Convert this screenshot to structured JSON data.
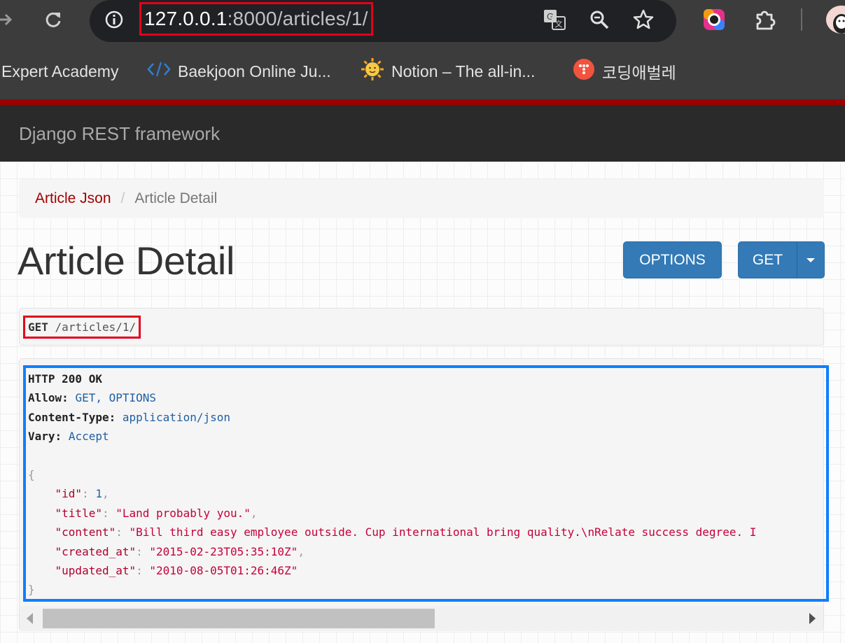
{
  "browser": {
    "url_host": "127.0.0.1",
    "url_path": ":8000/articles/1/",
    "icons": [
      "forward-icon",
      "reload-icon",
      "site-info-icon",
      "translate-icon",
      "zoom-icon",
      "star-icon",
      "extension-color-icon",
      "extensions-puzzle-icon",
      "profile-avatar"
    ],
    "bookmarks": [
      {
        "label": "Expert Academy",
        "icon": "none"
      },
      {
        "label": "Baekjoon Online Ju...",
        "icon": "code-brackets-icon"
      },
      {
        "label": "Notion – The all-in...",
        "icon": "sun-face-icon"
      },
      {
        "label": "코딩애벌레",
        "icon": "red-circle-icon"
      }
    ]
  },
  "navbar": {
    "brand": "Django REST framework"
  },
  "breadcrumb": {
    "link": "Article Json",
    "separator": "/",
    "active": "Article Detail"
  },
  "page": {
    "title": "Article Detail",
    "options_button": "OPTIONS",
    "get_button": "GET"
  },
  "request": {
    "method": "GET",
    "path": "/articles/1/"
  },
  "response": {
    "status": "HTTP 200 OK",
    "headers": [
      {
        "name": "Allow:",
        "value": "GET, OPTIONS"
      },
      {
        "name": "Content-Type:",
        "value": "application/json"
      },
      {
        "name": "Vary:",
        "value": "Accept"
      }
    ],
    "json": [
      {
        "key": "\"id\"",
        "value": "1",
        "type": "number",
        "comma": ","
      },
      {
        "key": "\"title\"",
        "value": "\"Land probably you.\"",
        "type": "string",
        "comma": ","
      },
      {
        "key": "\"content\"",
        "value": "\"Bill third easy employee outside. Cup international bring quality.\\nRelate success degree. I",
        "type": "string",
        "comma": ""
      },
      {
        "key": "\"created_at\"",
        "value": "\"2015-02-23T05:35:10Z\"",
        "type": "string",
        "comma": ","
      },
      {
        "key": "\"updated_at\"",
        "value": "\"2010-08-05T01:26:46Z\"",
        "type": "string",
        "comma": ""
      }
    ],
    "open_brace": "{",
    "close_brace": "}"
  },
  "colors": {
    "highlight_red": "#e3001b",
    "highlight_blue": "#0f7fff",
    "drf_red": "#9b0000",
    "button_blue": "#337ab7"
  }
}
